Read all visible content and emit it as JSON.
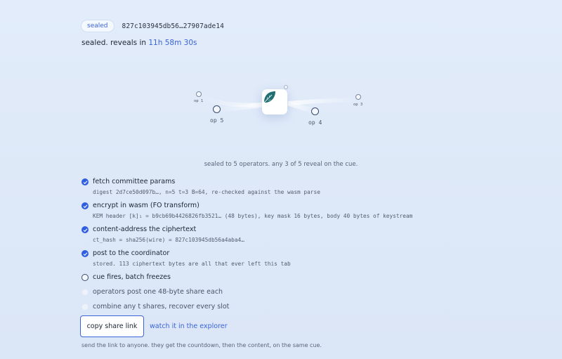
{
  "header": {
    "badge": "sealed",
    "hash": "827c103945db56…27907ade14"
  },
  "status": {
    "prefix": "sealed. reveals in ",
    "countdown": "11h 58m 30s"
  },
  "diagram": {
    "operators": [
      {
        "label": "op 1"
      },
      {
        "label": "op 5"
      },
      {
        "label": "op 4"
      },
      {
        "label": "op 3"
      }
    ],
    "center_icon": "leaf-icon"
  },
  "caption": "sealed to 5 operators. any 3 of 5 reveal on the cue.",
  "steps": [
    {
      "label": "fetch committee params",
      "detail": "digest 2d7ce50d097b…, n=5 t=3 B=64, re-checked against the wasm parse",
      "state": "done"
    },
    {
      "label": "encrypt in wasm (FO transform)",
      "detail": "KEM header [k]₁ = b9cb69b4426826fb3521… (48 bytes), key mask 16 bytes, body 40 bytes of keystream",
      "state": "done"
    },
    {
      "label": "content-address the ciphertext",
      "detail": "ct_hash = sha256(wire) = 827c103945db56a4aba4…",
      "state": "done"
    },
    {
      "label": "post to the coordinator",
      "detail": "stored. 113 ciphertext bytes are all that ever left this tab",
      "state": "done"
    },
    {
      "label": "cue fires, batch freezes",
      "detail": "",
      "state": "pending"
    },
    {
      "label": "operators post one 48-byte share each",
      "detail": "",
      "state": "future"
    },
    {
      "label": "combine any t shares, recover every slot",
      "detail": "",
      "state": "future"
    }
  ],
  "actions": {
    "copy_label": "copy share link",
    "explorer_label": "watch it in the explorer"
  },
  "footnote": "send the link to anyone. they get the countdown, then the content, on the same cue.",
  "colors": {
    "accent": "#3a64d8",
    "check": "#2f5fe0",
    "leaf": "#1f6e72"
  }
}
